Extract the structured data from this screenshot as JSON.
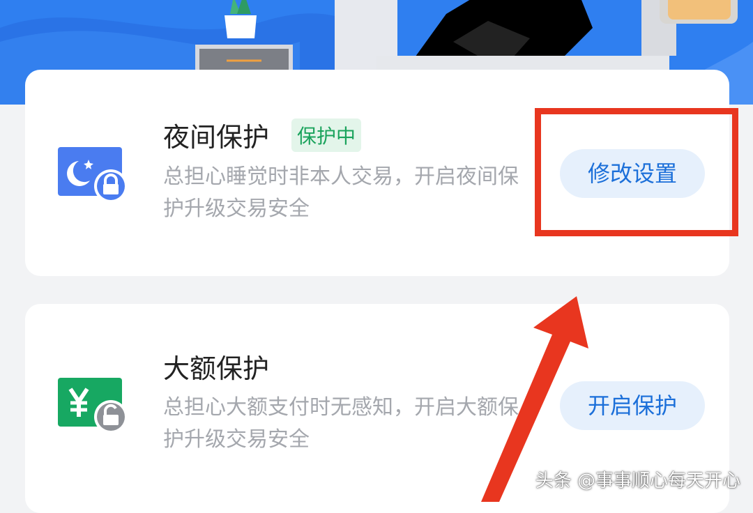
{
  "cards": [
    {
      "title": "夜间保护",
      "badge": "保护中",
      "description": "总担心睡觉时非本人交易，开启夜间保护升级交易安全",
      "button_label": "修改设置",
      "icon": "moon-lock-icon",
      "icon_color": "#4a7cf0"
    },
    {
      "title": "大额保护",
      "description": "总担心大额支付时无感知，开启大额保护升级交易安全",
      "button_label": "开启保护",
      "icon": "yuan-lock-icon",
      "icon_color": "#17a862"
    }
  ],
  "annotation": {
    "color": "#e8361f"
  },
  "watermark": "头条 @事事顺心每天开心"
}
